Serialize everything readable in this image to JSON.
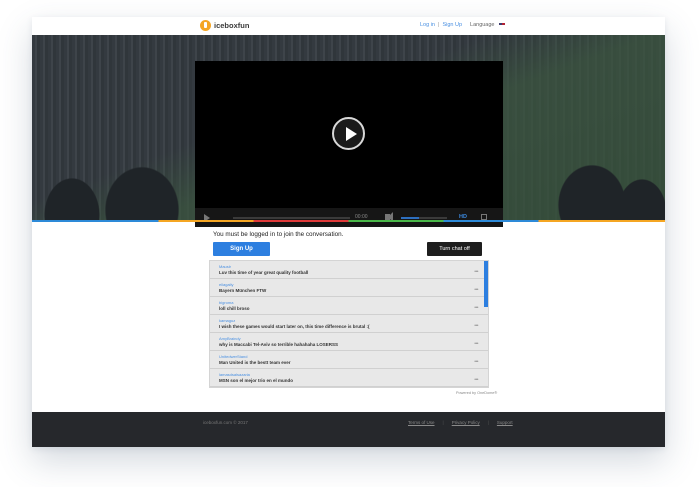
{
  "header": {
    "brand": "iceboxfun",
    "login": "Log in",
    "separator": "|",
    "signup": "Sign Up",
    "language": "Language"
  },
  "player": {
    "time": "00:00",
    "hd_label": "HD",
    "volume_level": 0.4
  },
  "chat": {
    "prompt": "You must be logged in to join the conversation.",
    "signup_button": "Sign Up",
    "chat_off_button": "Turn chat off",
    "more_label": "•••",
    "messages": [
      {
        "user": "Mauslr",
        "text": "Luv this time of year great quality football"
      },
      {
        "user": "ellagaliy",
        "text": "Bayern München FTW"
      },
      {
        "user": "bigroma",
        "text": "loll chill broso"
      },
      {
        "user": "kamaguz",
        "text": "I wish these games would start later on, this time difference is brutal :("
      },
      {
        "user": "AmyBraindy",
        "text": "why is Maccabi Tel-Aviv so terrible hahahaha LOSERSS"
      },
      {
        "user": "UnitedwerStand",
        "text": "Man United is the bestt team ever"
      },
      {
        "user": "lamasdsalsazaria",
        "text": "MSN son el mejor trio en el mundo"
      }
    ],
    "powered_by": "Powered by OneDome®"
  },
  "footer": {
    "copyright": "iceboxfun.com © 2017",
    "terms": "Terms of Use",
    "privacy": "Privacy Policy",
    "support": "Support",
    "separator": "|"
  },
  "colors": {
    "accent": "#2d7fe0",
    "logo": "#f5a623",
    "footer_bg": "#26282c"
  }
}
